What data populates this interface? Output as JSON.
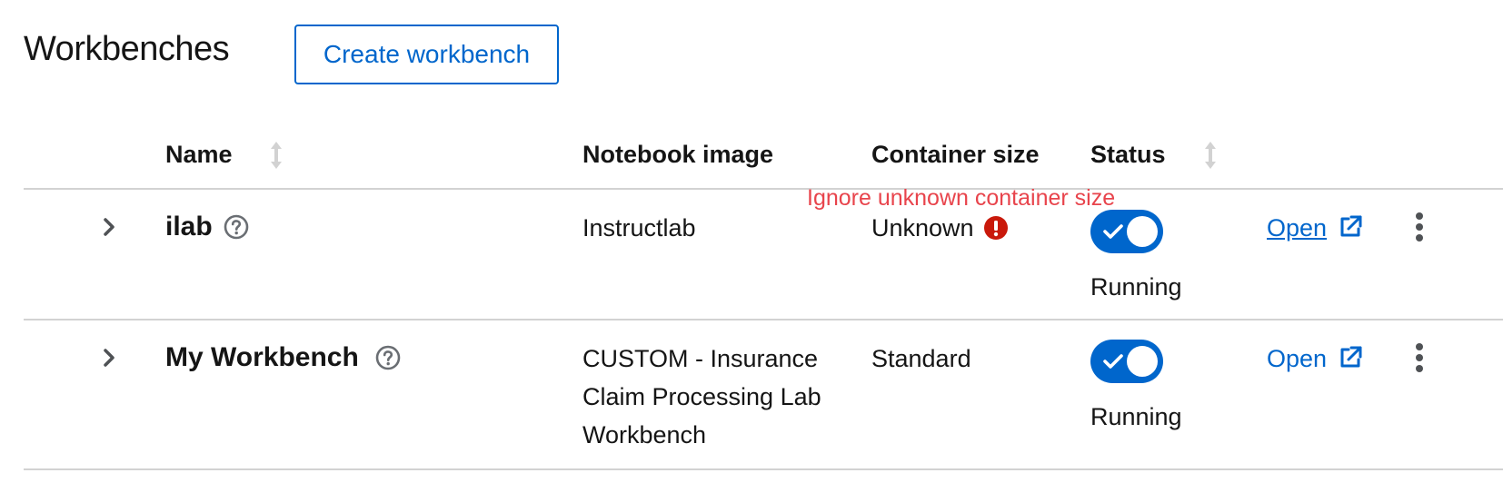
{
  "header": {
    "title": "Workbenches",
    "create_button_label": "Create workbench"
  },
  "table": {
    "columns": {
      "name": "Name",
      "notebook_image": "Notebook image",
      "container_size": "Container size",
      "status": "Status"
    },
    "rows": [
      {
        "name": "ilab",
        "notebook_image": "Instructlab",
        "container_size": "Unknown",
        "status": "Running",
        "open_label": "Open"
      },
      {
        "name": "My Workbench",
        "notebook_image": "CUSTOM - Insurance Claim Processing Lab Workbench",
        "container_size": "Standard",
        "status": "Running",
        "open_label": "Open"
      }
    ]
  },
  "annotation": "Ignore unknown container size",
  "colors": {
    "accent": "#0066cc",
    "danger": "#c9190b",
    "annotation": "#e8444c",
    "divider": "#d2d2d2"
  },
  "icons": {
    "sort": "sort-icon",
    "expand": "chevron-right-icon",
    "help": "question-circle-icon",
    "warning": "exclamation-circle-icon",
    "external": "external-link-icon",
    "kebab": "kebab-menu-icon",
    "check": "check-icon"
  }
}
